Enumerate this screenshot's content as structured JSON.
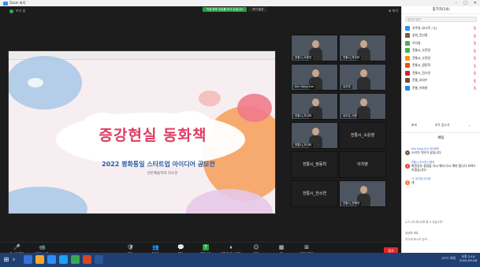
{
  "window": {
    "title": "Zoom 회의"
  },
  "meeting": {
    "share_status": "직접 화면 공유를 보고 있습니다",
    "view_options": "보기 옵션",
    "top_left_label": "보기 옵",
    "view_button": "보기"
  },
  "slide": {
    "title": "증강현실 동화책",
    "subtitle": "2022 평화통일 스타트업 아이디어 공모전",
    "department": "산문예술학과 이소현"
  },
  "participants_grid": [
    {
      "name": "전통시_오윤영",
      "video": true
    },
    {
      "name": "전통시_박요한",
      "video": true
    },
    {
      "name": "Kim Sang Eun",
      "video": true
    },
    {
      "name": "유주영",
      "video": true
    },
    {
      "name": "전통시_오나희",
      "video": true
    },
    {
      "name": "유주은_서현",
      "video": true
    },
    {
      "name": "전통시_오나희",
      "video": true
    },
    {
      "name": "전통시_소윤영",
      "video": false
    },
    {
      "name": "전통시_정동혁",
      "video": false
    },
    {
      "name": "이지영",
      "video": false
    },
    {
      "name": "전통시_전소연",
      "video": false
    },
    {
      "name": "전통시_전해영",
      "video": true
    }
  ],
  "toolbar": {
    "items": [
      {
        "label": "음소거 해제",
        "icon": "🎤"
      },
      {
        "label": "비디오 시작",
        "icon": "📹"
      },
      {
        "label": "보안",
        "icon": "🛡"
      },
      {
        "label": "참가자",
        "icon": "👥"
      },
      {
        "label": "채팅",
        "icon": "💬"
      },
      {
        "label": "화면 공유",
        "icon": "↑"
      },
      {
        "label": "기록 중 일시 중지/중지",
        "icon": "⏸"
      },
      {
        "label": "반응",
        "icon": "☺"
      },
      {
        "label": "앱",
        "icon": "▦"
      },
      {
        "label": "회의실 열기",
        "icon": "⊞"
      }
    ],
    "end_label": "종료"
  },
  "sidebar": {
    "title": "참가자(14)",
    "search_placeholder": "참가자 찾기",
    "participants": [
      {
        "name": "유주영 (호스트, 나)",
        "color": "#2d8cff"
      },
      {
        "name": "송희_윤선영",
        "color": "#7a5c3a"
      },
      {
        "name": "이지영",
        "color": "#4caf50"
      },
      {
        "name": "전통시_오윤영",
        "color": "#4caf50"
      },
      {
        "name": "전통시_소윤영",
        "color": "#ff8f00"
      },
      {
        "name": "전통시_정동혁",
        "color": "#e65100"
      },
      {
        "name": "전통시_전소연",
        "color": "#c62828"
      },
      {
        "name": "전통_오대수",
        "color": "#6d4c41"
      },
      {
        "name": "전통_이화영",
        "color": "#1e88e5"
      }
    ],
    "invite_label": "초대",
    "mute_all_label": "모두 음소거",
    "more_label": "..."
  },
  "chat": {
    "title": "채팅",
    "messages": [
      {
        "from": "Kim Sang Eun 모두에게",
        "avatar": "K",
        "avatar_color": "#795548",
        "text": "소리가 작은거 같습니다."
      },
      {
        "from": "전통시_이소현 나에게",
        "avatar": "전",
        "avatar_color": "#e53935",
        "text": "화면공유 설정을 다시 해서 다시 해야 합니다 보여드리겠습니다!"
      },
      {
        "from": "나: 유주영_이소현",
        "avatar": "유",
        "avatar_color": "#ff7043",
        "text": "네"
      }
    ],
    "notice": "누가 나의 메시지를 볼 수 있습니까?",
    "to_label": "수신자: 모두",
    "input_placeholder": "여기에 메시지 입력..."
  },
  "taskbar": {
    "weather": "21°C 흐림",
    "time": "오후 2:14",
    "date": "2022-05-26"
  }
}
